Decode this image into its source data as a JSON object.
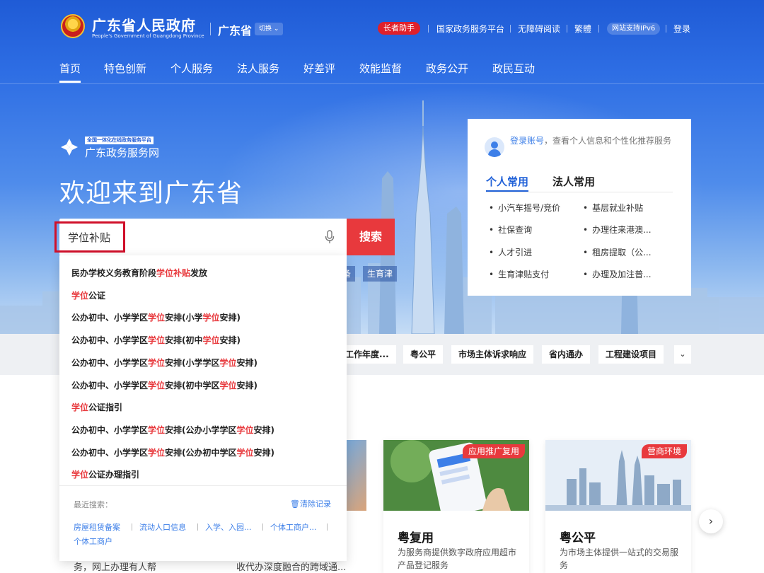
{
  "header": {
    "site_title": "广东省人民政府",
    "site_subtitle": "People's Government of Guangdong Province",
    "region": "广东省",
    "switch_label": "切换",
    "elder_label": "长者助手",
    "links": [
      "国家政务服务平台",
      "无障碍阅读",
      "繁體"
    ],
    "ipv6_label": "网站支持IPv6",
    "login_label": "登录"
  },
  "nav": {
    "items": [
      "首页",
      "特色创新",
      "个人服务",
      "法人服务",
      "好差评",
      "效能监督",
      "政务公开",
      "政民互动"
    ]
  },
  "service": {
    "badge": "全国一体化在线政务服务平台",
    "name": "广东政务服务网",
    "welcome": "欢迎来到广东省"
  },
  "search": {
    "value": "学位补贴",
    "button_label": "搜索",
    "peek_chips": [
      "备",
      "生育津"
    ]
  },
  "suggestions": [
    [
      [
        "民办学校义务教育阶段",
        false
      ],
      [
        "学位补贴",
        true
      ],
      [
        "发放",
        false
      ]
    ],
    [
      [
        "学位",
        true
      ],
      [
        "公证",
        false
      ]
    ],
    [
      [
        "公办初中、小学学区",
        false
      ],
      [
        "学位",
        true
      ],
      [
        "安排(小学",
        false
      ],
      [
        "学位",
        true
      ],
      [
        "安排)",
        false
      ]
    ],
    [
      [
        "公办初中、小学学区",
        false
      ],
      [
        "学位",
        true
      ],
      [
        "安排(初中",
        false
      ],
      [
        "学位",
        true
      ],
      [
        "安排)",
        false
      ]
    ],
    [
      [
        "公办初中、小学学区",
        false
      ],
      [
        "学位",
        true
      ],
      [
        "安排(小学学区",
        false
      ],
      [
        "学位",
        true
      ],
      [
        "安排)",
        false
      ]
    ],
    [
      [
        "公办初中、小学学区",
        false
      ],
      [
        "学位",
        true
      ],
      [
        "安排(初中学区",
        false
      ],
      [
        "学位",
        true
      ],
      [
        "安排)",
        false
      ]
    ],
    [
      [
        "学位",
        true
      ],
      [
        "公证指引",
        false
      ]
    ],
    [
      [
        "公办初中、小学学区",
        false
      ],
      [
        "学位",
        true
      ],
      [
        "安排(公办小学学区",
        false
      ],
      [
        "学位",
        true
      ],
      [
        "安排)",
        false
      ]
    ],
    [
      [
        "公办初中、小学学区",
        false
      ],
      [
        "学位",
        true
      ],
      [
        "安排(公办初中学区",
        false
      ],
      [
        "学位",
        true
      ],
      [
        "安排)",
        false
      ]
    ],
    [
      [
        "学位",
        true
      ],
      [
        "公证办理指引",
        false
      ]
    ]
  ],
  "recent": {
    "label": "最近搜索：",
    "clear_label": "清除记录",
    "items": [
      "房屋租赁备案",
      "流动人口信息",
      "入学、入园...",
      "个体工商户...",
      "个体工商户"
    ]
  },
  "login_card": {
    "link": "登录账号",
    "text": "，查看个人信息和个性化推荐服务",
    "tabs": [
      "个人常用",
      "法人常用"
    ],
    "left_items": [
      "小汽车摇号/竞价",
      "社保查询",
      "人才引进",
      "生育津贴支付"
    ],
    "right_items": [
      "基层就业补贴",
      "办理往来港澳...",
      "租房提取（公...",
      "办理及加注普..."
    ]
  },
  "strip_tags": [
    "工作年度...",
    "粤公平",
    "市场主体诉求响应",
    "省内通办",
    "工程建设项目"
  ],
  "app_cards": [
    {
      "badge": "应用推广复用",
      "title": "粤复用",
      "desc": "为服务商提供数字政府应用超市产品登记服务"
    },
    {
      "badge": "营商环境",
      "title": "粤公平",
      "desc": "为市场主体提供一站式的交易服务"
    }
  ],
  "peek_texts": [
    "务，网上办理有人帮",
    "收代办深度融合的跨域通..."
  ],
  "colors": {
    "brand_blue": "#2262d8",
    "accent_red": "#e8393d",
    "highlight": "#d0102a"
  }
}
